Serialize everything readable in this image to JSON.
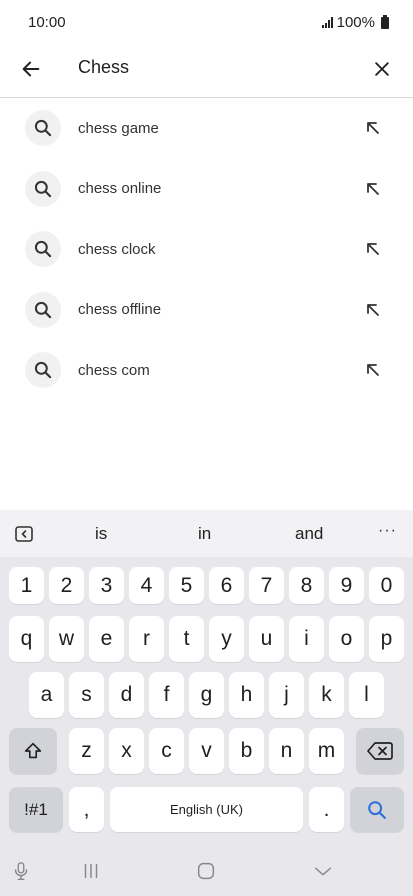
{
  "status": {
    "time": "10:00",
    "battery": "100%"
  },
  "search": {
    "query": "Chess"
  },
  "suggestions": [
    {
      "label": "chess game"
    },
    {
      "label": "chess online"
    },
    {
      "label": "chess clock"
    },
    {
      "label": "chess offline"
    },
    {
      "label": "chess com"
    }
  ],
  "keyboard": {
    "predictions": [
      "is",
      "in",
      "and"
    ],
    "more": "···",
    "row_numbers": [
      "1",
      "2",
      "3",
      "4",
      "5",
      "6",
      "7",
      "8",
      "9",
      "0"
    ],
    "row_top": [
      "q",
      "w",
      "e",
      "r",
      "t",
      "y",
      "u",
      "i",
      "o",
      "p"
    ],
    "row_middle": [
      "a",
      "s",
      "d",
      "f",
      "g",
      "h",
      "j",
      "k",
      "l"
    ],
    "row_bottom": [
      "z",
      "x",
      "c",
      "v",
      "b",
      "n",
      "m"
    ],
    "symbols_label": "!#1",
    "comma": ",",
    "space_label": "English (UK)",
    "period": "."
  },
  "colors": {
    "accent": "#2f6fdc",
    "keyboard_bg": "#e8e8ec",
    "key_dark": "#d2d3d8"
  }
}
